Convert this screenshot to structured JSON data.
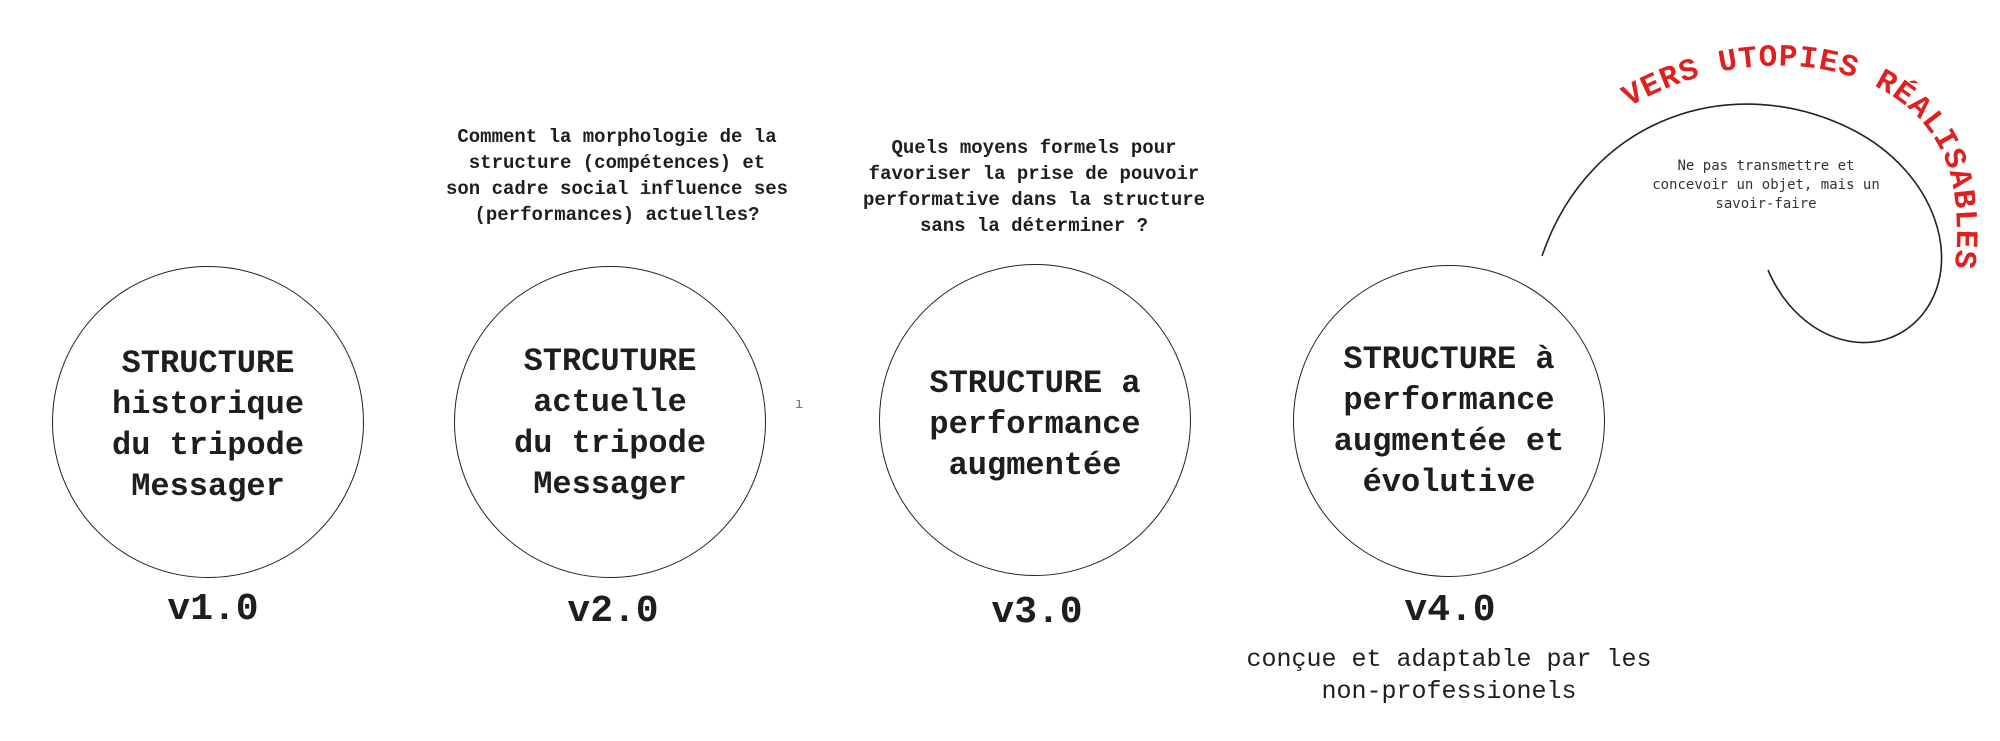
{
  "colors": {
    "ink": "#1e1e1e",
    "accent": "#e0201e"
  },
  "structures": [
    {
      "label": "STRUCTURE\nhistorique\ndu tripode\nMessager",
      "version": "v1.0"
    },
    {
      "label": "STRCUTURE\nactuelle\ndu tripode\nMessager",
      "version": "v2.0",
      "question": "Comment la morphologie de la\nstructure (compétences) et\nson cadre social influence ses\n(performances) actuelles?"
    },
    {
      "label": "STRUCTURE a\nperformance\naugmentée",
      "version": "v3.0",
      "question": "Quels moyens formels pour\nfavoriser la prise de pouvoir\nperformative dans la structure\nsans la déterminer ?"
    },
    {
      "label": "STRUCTURE  à\nperformance\naugmentée et\névolutive",
      "version": "v4.0",
      "caption": "conçue et adaptable par les\nnon-professionels"
    }
  ],
  "utopia": {
    "title": "VERS UTOPIES RÉALISABLES",
    "note": "Ne pas transmettre et\nconcevoir un objet, mais un\nsavoir-faire"
  },
  "stray_mark": "ı"
}
